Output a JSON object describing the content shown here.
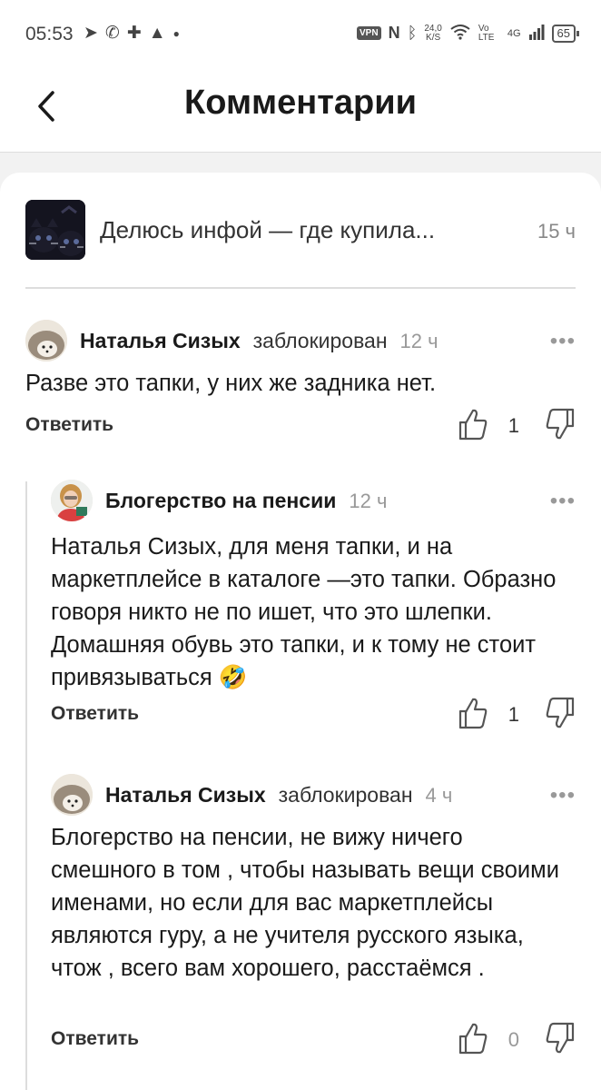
{
  "status_bar": {
    "time": "05:53",
    "vpn": "VPN",
    "net_speed_value": "24,0",
    "net_speed_unit": "K/S",
    "volte": "Vo LTE",
    "network": "4G",
    "battery": "65"
  },
  "header": {
    "title": "Комментарии"
  },
  "article": {
    "title": "Делюсь инфой — где купила...",
    "time": "15 ч"
  },
  "comments": [
    {
      "author": "Наталья Сизых",
      "status": "заблокирован",
      "time": "12 ч",
      "text": "Разве это тапки, у них же задника нет.",
      "reply_label": "Ответить",
      "likes": "1"
    },
    {
      "author": "Блогерство на пенсии",
      "time": "12 ч",
      "text": "Наталья Сизых, для меня тапки, и на маркетплейсе в каталоге —это тапки. Образно говоря никто не по ишет, что это шлепки. Домашняя обувь это тапки, и к тому не стоит привязываться 🤣",
      "reply_label": "Ответить",
      "likes": "1"
    },
    {
      "author": "Наталья Сизых",
      "status": "заблокирован",
      "time": "4 ч",
      "text": "Блогерство на пенсии, не вижу ничего смешного в том , чтобы называть вещи своими именами, но если для вас маркетплейсы являются гуру, а не учителя русского языка, чтож , всего вам хорошего, расстаёмся .",
      "reply_label": "Ответить",
      "likes": "0"
    }
  ]
}
